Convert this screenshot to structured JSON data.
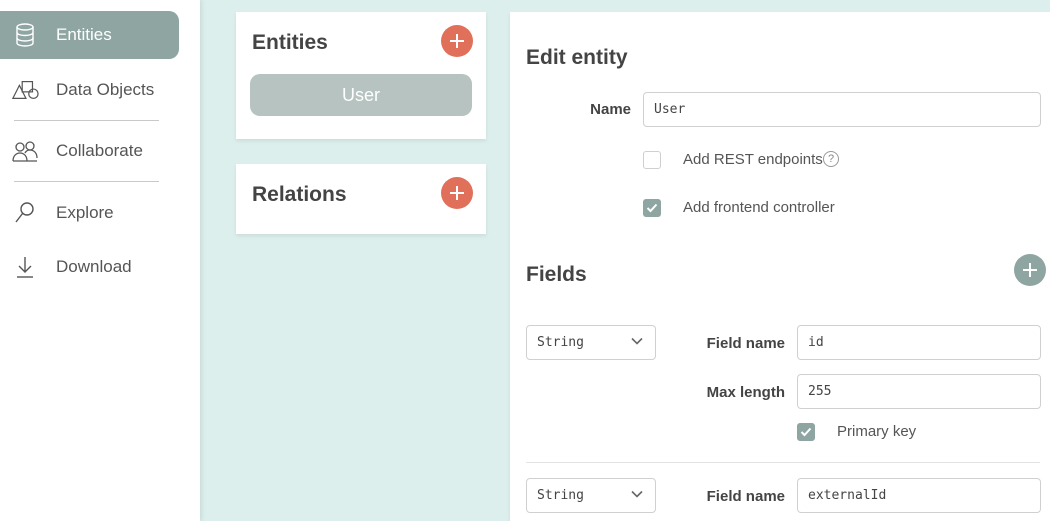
{
  "sidebar": {
    "items": [
      {
        "label": "Entities",
        "icon": "database-icon",
        "active": true
      },
      {
        "label": "Data Objects",
        "icon": "shapes-icon"
      },
      {
        "label": "Collaborate",
        "icon": "collaborate-icon"
      },
      {
        "label": "Explore",
        "icon": "magnifier-icon"
      },
      {
        "label": "Download",
        "icon": "download-icon"
      }
    ]
  },
  "entities_card": {
    "title": "Entities",
    "items": [
      "User"
    ]
  },
  "relations_card": {
    "title": "Relations"
  },
  "edit_entity": {
    "title": "Edit entity",
    "name_label": "Name",
    "name_value": "User",
    "rest_label": "Add REST endpoints",
    "rest_checked": false,
    "frontend_label": "Add frontend controller",
    "frontend_checked": true,
    "help_glyph": "?"
  },
  "fields_section": {
    "title": "Fields",
    "field_name_label": "Field name",
    "max_length_label": "Max length",
    "primary_key_label": "Primary key",
    "fields": [
      {
        "type": "String",
        "name": "id",
        "max_length": "255",
        "primary_key": true
      },
      {
        "type": "String",
        "name": "externalId"
      }
    ]
  },
  "colors": {
    "accent": "#8ea5a2",
    "add": "#e0705a",
    "background": "#dcefec"
  }
}
